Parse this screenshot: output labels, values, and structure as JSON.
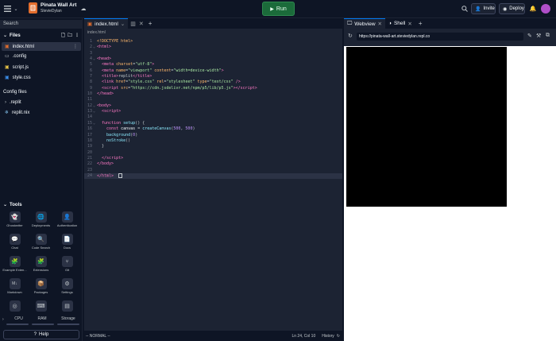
{
  "app": {
    "repl_name": "Pinata Wall Art",
    "owner": "StevieDylan"
  },
  "header": {
    "run_label": "Run",
    "invite_label": "Invite",
    "deploy_label": "Deploy"
  },
  "sidebar": {
    "search_placeholder": "Search",
    "files_title": "Files",
    "files": [
      {
        "name": "index.html",
        "icon": "html-file-icon"
      },
      {
        "name": ".config",
        "icon": "folder-icon"
      },
      {
        "name": "script.js",
        "icon": "js-file-icon"
      },
      {
        "name": "style.css",
        "icon": "css-file-icon"
      }
    ],
    "config_title": "Config files",
    "config_files": [
      {
        "name": ".replit",
        "icon": "replit-file-icon"
      },
      {
        "name": "replit.nix",
        "icon": "nix-file-icon"
      }
    ],
    "tools_title": "Tools",
    "tools": [
      {
        "label": "Ghostwriter",
        "glyph": "👻"
      },
      {
        "label": "Deployments",
        "glyph": "🌐"
      },
      {
        "label": "Authentication",
        "glyph": "👤"
      },
      {
        "label": "Chat",
        "glyph": "💬"
      },
      {
        "label": "Code Search",
        "glyph": "🔍"
      },
      {
        "label": "Docs",
        "glyph": "📄"
      },
      {
        "label": "Example Exten...",
        "glyph": "🧩"
      },
      {
        "label": "Extensions",
        "glyph": "🧩"
      },
      {
        "label": "Git",
        "glyph": "⑂"
      },
      {
        "label": "Markdown",
        "glyph": "M↓"
      },
      {
        "label": "Packages",
        "glyph": "📦"
      },
      {
        "label": "Settings",
        "glyph": "⚙"
      }
    ],
    "usage": [
      "CPU",
      "RAM",
      "Storage"
    ],
    "help_label": "Help"
  },
  "editor": {
    "tab_label": "index.html",
    "breadcrumb": "index.html",
    "lines": [
      {
        "n": "1",
        "fold": "",
        "html": "<span style='color:#ffb86c'>&lt;!DOCTYPE html&gt;</span>"
      },
      {
        "n": "2",
        "fold": "⌄",
        "html": "<span style='color:#ff79c6'>&lt;html&gt;</span>"
      },
      {
        "n": "3",
        "fold": "",
        "html": ""
      },
      {
        "n": "4",
        "fold": "⌄",
        "html": "<span style='color:#ff79c6'>&lt;head&gt;</span>"
      },
      {
        "n": "5",
        "fold": "",
        "html": "  <span style='color:#ff79c6'>&lt;meta</span> <span style='color:#ffb86c'>charset</span>=<span style='color:#a8e6a1'>\"utf-8\"</span><span style='color:#ff79c6'>&gt;</span>"
      },
      {
        "n": "6",
        "fold": "",
        "html": "  <span style='color:#ff79c6'>&lt;meta</span> <span style='color:#ffb86c'>name</span>=<span style='color:#a8e6a1'>\"viewport\"</span> <span style='color:#ffb86c'>content</span>=<span style='color:#a8e6a1'>\"width=device-width\"</span><span style='color:#ff79c6'>&gt;</span>"
      },
      {
        "n": "7",
        "fold": "",
        "html": "  <span style='color:#ff79c6'>&lt;title&gt;</span>replit<span style='color:#ff79c6'>&lt;/title&gt;</span>"
      },
      {
        "n": "8",
        "fold": "",
        "html": "  <span style='color:#ff79c6'>&lt;link</span> <span style='color:#ffb86c'>href</span>=<span style='color:#a8e6a1'>\"style.css\"</span> <span style='color:#ffb86c'>rel</span>=<span style='color:#a8e6a1'>\"stylesheet\"</span> <span style='color:#ffb86c'>type</span>=<span style='color:#a8e6a1'>\"text/css\"</span> <span style='color:#ff79c6'>/&gt;</span>"
      },
      {
        "n": "9",
        "fold": "",
        "html": "  <span style='color:#ff79c6'>&lt;script</span> <span style='color:#ffb86c'>src</span>=<span style='color:#a8e6a1'>\"https://cdn.jsdelivr.net/npm/p5/lib/p5.js\"</span><span style='color:#ff79c6'>&gt;&lt;/script&gt;</span>"
      },
      {
        "n": "10",
        "fold": "",
        "html": "<span style='color:#ff79c6'>&lt;/head&gt;</span>"
      },
      {
        "n": "11",
        "fold": "",
        "html": ""
      },
      {
        "n": "12",
        "fold": "⌄",
        "html": "<span style='color:#ff79c6'>&lt;body&gt;</span>"
      },
      {
        "n": "13",
        "fold": "⌄",
        "html": "  <span style='color:#ff79c6'>&lt;script&gt;</span>"
      },
      {
        "n": "14",
        "fold": "",
        "html": ""
      },
      {
        "n": "15",
        "fold": "⌄",
        "html": "  <span style='color:#ff79c6'>function</span> <span style='color:#8be9fd'>setup</span>() {"
      },
      {
        "n": "16",
        "fold": "",
        "html": "    <span style='color:#ff79c6'>const</span> <span style='color:#f5f9fc'>canvas</span> = <span style='color:#8be9fd'>createCanvas</span>(<span style='color:#bd93f9'>500</span>, <span style='color:#bd93f9'>500</span>)"
      },
      {
        "n": "17",
        "fold": "",
        "html": "    <span style='color:#8be9fd'>background</span>(<span style='color:#bd93f9'>0</span>)"
      },
      {
        "n": "18",
        "fold": "",
        "html": "    <span style='color:#8be9fd'>noStroke</span>()"
      },
      {
        "n": "19",
        "fold": "",
        "html": "  }"
      },
      {
        "n": "20",
        "fold": "",
        "html": ""
      },
      {
        "n": "21",
        "fold": "",
        "html": "  <span style='color:#ff79c6'>&lt;/script&gt;</span>"
      },
      {
        "n": "22",
        "fold": "",
        "html": "<span style='color:#ff79c6'>&lt;/body&gt;</span>"
      },
      {
        "n": "23",
        "fold": "",
        "html": ""
      },
      {
        "n": "24",
        "fold": "",
        "html": "<span style='color:#ff79c6'>&lt;/html&gt;</span>  <span style='border:1px solid #c2c8cc;display:inline-block;width:5px;height:6px;vertical-align:middle'></span>",
        "cursor": true
      }
    ],
    "status_mode": "-- NORMAL --",
    "status_position": "Ln 24, Col 10",
    "status_history": "History"
  },
  "webview": {
    "tab_webview": "Webview",
    "tab_shell": "Shell",
    "url": "https://pinata-wall-art.steviedylan.repl.co"
  },
  "colors": {
    "bg": "#0e1525",
    "panel": "#1c2333",
    "accent": "#0079f2",
    "run_green": "#1b6b3a"
  }
}
